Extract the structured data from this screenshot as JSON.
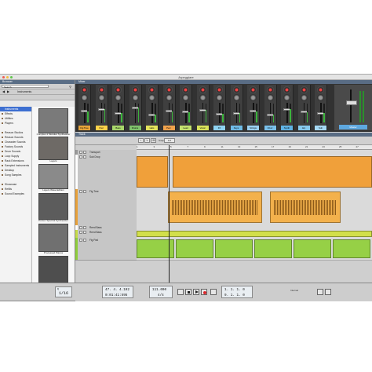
{
  "window": {
    "title": "Arpeggiare"
  },
  "browser": {
    "header": "Browser",
    "search_placeholder": "Search",
    "folder": "Instruments",
    "locations": [
      "Instruments",
      "Effects",
      "Utilities",
      "Players",
      "",
      "Reason Studios",
      "Reason Sounds",
      "Character Sounds",
      "Factory Sounds",
      "Drum Sounds",
      "Loop Supply",
      "Rack Extensions",
      "Sampled Instruments",
      "Desktop",
      "Song Samples",
      "",
      "Showcase",
      "Refills",
      "Sound Examples"
    ],
    "selected_index": 0,
    "thumbnails": [
      "Complex-1 Modular Synthesizer",
      "Layers",
      "Layers Wave Edition",
      "Parsec Spectral Synthesizer",
      "Processed Pianos",
      "PX7 FM Synthesizer"
    ],
    "create_label": "Create"
  },
  "mixer": {
    "header": "Mixer",
    "channels": [
      {
        "label": "Fig Tree",
        "color": "#e7a53a",
        "level": 0.6
      },
      {
        "label": "Pad",
        "color": "#ffd24a",
        "level": 0.7
      },
      {
        "label": "Bass",
        "color": "#a8d66a",
        "level": 0.5
      },
      {
        "label": "Drums",
        "color": "#7fc26b",
        "level": 0.8
      },
      {
        "label": "Hats",
        "color": "#e4e45c",
        "level": 0.4
      },
      {
        "label": "Perc",
        "color": "#f0a24c",
        "level": 0.6
      },
      {
        "label": "Lead",
        "color": "#c3e16e",
        "level": 0.55
      },
      {
        "label": "Vocal",
        "color": "#d9e35a",
        "level": 0.65
      },
      {
        "label": "FX",
        "color": "#8ed2f0",
        "level": 0.45
      },
      {
        "label": "Keys",
        "color": "#6fbbe6",
        "level": 0.5
      },
      {
        "label": "Strings",
        "color": "#9ad0f2",
        "level": 0.6
      },
      {
        "label": "Choir",
        "color": "#7ac0ea",
        "level": 0.4
      },
      {
        "label": "Synth",
        "color": "#5fb2e4",
        "level": 0.7
      },
      {
        "label": "Arp",
        "color": "#86c9ee",
        "level": 0.55
      },
      {
        "label": "Sub",
        "color": "#a5d8f4",
        "level": 0.5
      }
    ],
    "master_label": "Master"
  },
  "sequencer": {
    "header": "Track",
    "snap_value": "1/2",
    "ruler_ticks": [
      "1",
      "3",
      "5",
      "7",
      "9",
      "11",
      "13",
      "15",
      "17",
      "19",
      "21",
      "23",
      "25",
      "27"
    ],
    "tracks": [
      {
        "name": "Transport",
        "color": "#9a9a9a"
      },
      {
        "name": "Sub Drop",
        "color": "#ffffff"
      },
      {
        "name": "Fig Tree",
        "color": "#e8a13a"
      },
      {
        "name": "Reed Bass",
        "color": "#ffffff"
      },
      {
        "name": "Reed Bass",
        "color": "#c6dc49"
      },
      {
        "name": "Fig Pad",
        "color": "#8fcd3b"
      }
    ]
  },
  "transport": {
    "quantize_label": "Q",
    "bars": "1/16",
    "position": "47. 4. 4.192",
    "time": "0:01:41:595",
    "tempo": "111.000",
    "signature": "4/4",
    "loop_left": "1. 1. 1. 0",
    "loop_right": "9. 1. 1. 0",
    "sync_label": "Internal"
  }
}
